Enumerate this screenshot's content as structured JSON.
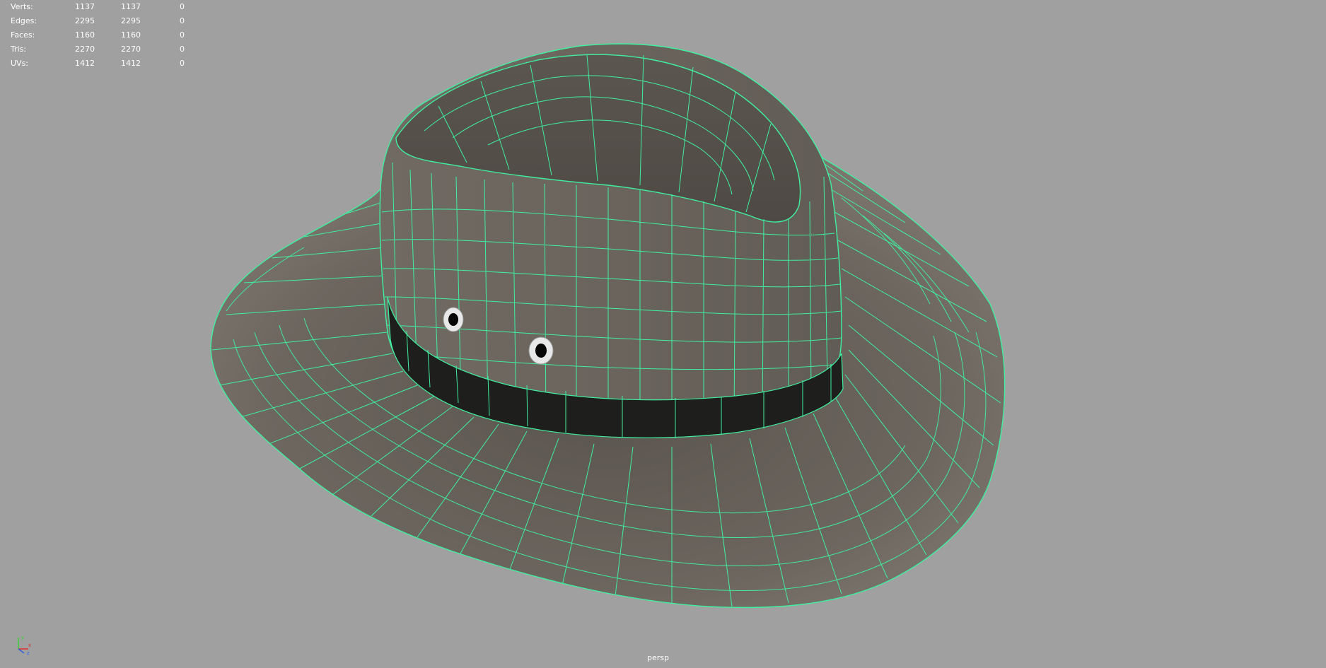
{
  "hud": {
    "rows": [
      {
        "label": "Verts:",
        "a": "1137",
        "b": "1137",
        "c": "0"
      },
      {
        "label": "Edges:",
        "a": "2295",
        "b": "2295",
        "c": "0"
      },
      {
        "label": "Faces:",
        "a": "1160",
        "b": "1160",
        "c": "0"
      },
      {
        "label": "Tris:",
        "a": "2270",
        "b": "2270",
        "c": "0"
      },
      {
        "label": "UVs:",
        "a": "1412",
        "b": "1412",
        "c": "0"
      }
    ]
  },
  "camera": {
    "name": "persp"
  },
  "axis": {
    "x": "x",
    "y": "y",
    "z": "z"
  },
  "colors": {
    "background": "#a0a0a0",
    "wireframe": "#3ff0a0",
    "hat_fabric": "#6e6862",
    "hat_band": "#1e1e1c",
    "hud_text": "#ffffff"
  },
  "scene": {
    "object": "hat-mesh",
    "display": "wireframe-on-shaded"
  }
}
